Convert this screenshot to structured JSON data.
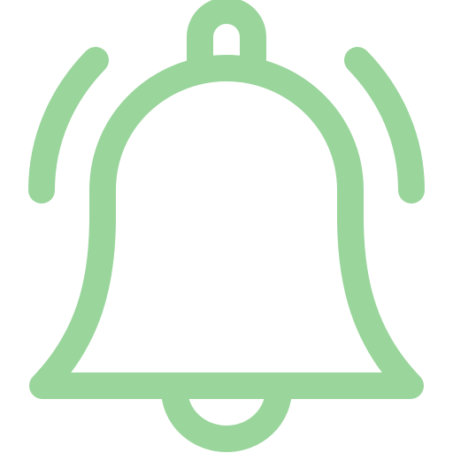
{
  "icon": {
    "name": "bell-ringing-icon",
    "style": "outline",
    "stroke_color": "#9AD59C",
    "background": "#FFFFFF"
  }
}
